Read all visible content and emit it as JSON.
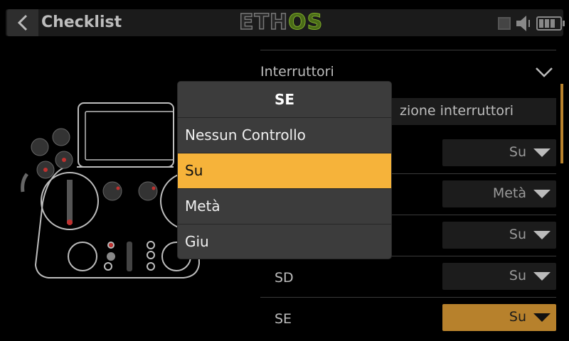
{
  "header": {
    "title": "Checklist",
    "logo_left": "ETH",
    "logo_right": "OS"
  },
  "section": {
    "label": "Interruttori",
    "button_text": "zione interruttori"
  },
  "rows": [
    {
      "label": "",
      "value": "Su"
    },
    {
      "label": "",
      "value": "Metà"
    },
    {
      "label": "",
      "value": "Su"
    },
    {
      "label": "SD",
      "value": "Su"
    },
    {
      "label": "SE",
      "value": "Su"
    }
  ],
  "popup": {
    "title": "SE",
    "options": [
      "Nessun Controllo",
      "Su",
      "Metà",
      "Giu"
    ],
    "selected_index": 1
  },
  "colors": {
    "accent": "#f6b33a",
    "active_dropdown": "#b7812c",
    "logo_os": "#7fae2a"
  }
}
